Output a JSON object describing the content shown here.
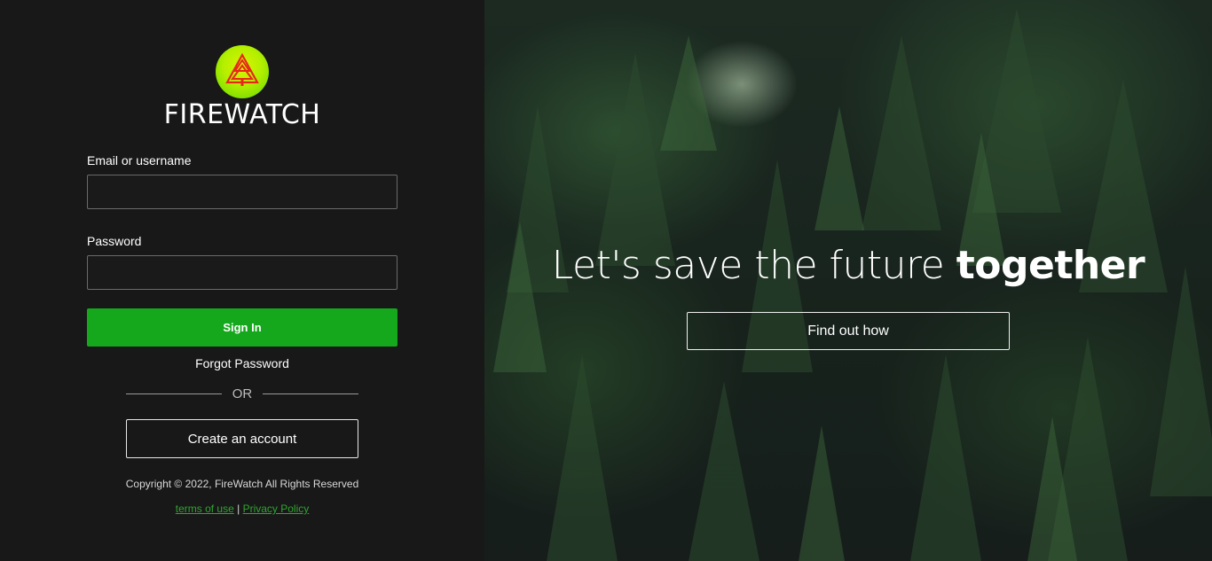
{
  "brand": {
    "name": "FIREWATCH",
    "logo_icon": "triangle-tree-icon",
    "logo_colors": {
      "badge": "#b5ef00",
      "tree": "#e8261c"
    }
  },
  "login": {
    "email_label": "Email or username",
    "email_value": "",
    "password_label": "Password",
    "password_value": "",
    "signin_label": "Sign In",
    "forgot_label": "Forgot Password",
    "or_label": "OR",
    "create_account_label": "Create an account",
    "copyright": "Copyright © 2022, FireWatch All Rights Reserved",
    "terms_label": "terms of use",
    "separator": "|",
    "privacy_label": "Privacy Policy"
  },
  "hero": {
    "heading_main": "Let's save the future ",
    "heading_emphasis": "together",
    "button_label": "Find out how"
  },
  "colors": {
    "accent_green": "#15a81c",
    "link_green": "#2ea52f",
    "panel_bg": "#181818"
  }
}
